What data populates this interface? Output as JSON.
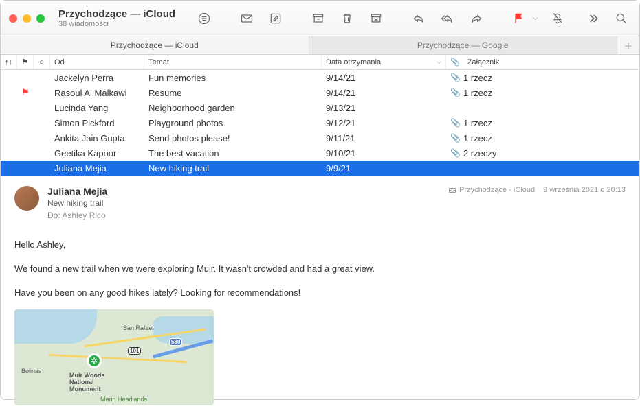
{
  "title": "Przychodzące — iCloud",
  "subtitle": "38 wiadomości",
  "tabs": [
    {
      "label": "Przychodzące — iCloud",
      "active": true
    },
    {
      "label": "Przychodzące — Google",
      "active": false
    }
  ],
  "columns": {
    "from": "Od",
    "subject": "Temat",
    "date": "Data otrzymania",
    "attachment": "Załącznik"
  },
  "messages": [
    {
      "flagged": false,
      "from": "Jackelyn Perra",
      "subject": "Fun memories",
      "date": "9/14/21",
      "attach": "1 rzecz"
    },
    {
      "flagged": true,
      "from": "Rasoul Al Malkawi",
      "subject": "Resume",
      "date": "9/14/21",
      "attach": "1 rzecz"
    },
    {
      "flagged": false,
      "from": "Lucinda Yang",
      "subject": "Neighborhood garden",
      "date": "9/13/21",
      "attach": ""
    },
    {
      "flagged": false,
      "from": "Simon Pickford",
      "subject": "Playground photos",
      "date": "9/12/21",
      "attach": "1 rzecz"
    },
    {
      "flagged": false,
      "from": "Ankita Jain Gupta",
      "subject": "Send photos please!",
      "date": "9/11/21",
      "attach": "1 rzecz"
    },
    {
      "flagged": false,
      "from": "Geetika Kapoor",
      "subject": "The best vacation",
      "date": "9/10/21",
      "attach": "2 rzeczy"
    },
    {
      "flagged": false,
      "from": "Juliana Mejia",
      "subject": "New hiking trail",
      "date": "9/9/21",
      "attach": "",
      "selected": true
    }
  ],
  "preview": {
    "from": "Juliana Mejia",
    "subject": "New hiking trail",
    "to_label": "Do:",
    "to": "Ashley Rico",
    "inbox": "Przychodzące - iCloud",
    "timestamp": "9 września 2021 o 20:13",
    "body": [
      "Hello Ashley,",
      "We found a new trail when we were exploring Muir. It wasn't crowded and had a great view.",
      "Have you been on any good hikes lately? Looking for recommendations!"
    ]
  },
  "map": {
    "labels": {
      "sanrafael": "San Rafael",
      "bolinas": "Bolinas",
      "muir": "Muir Woods National Monument",
      "marin": "Marin Headlands"
    },
    "shields": {
      "r101": "101",
      "r580": "580"
    }
  }
}
